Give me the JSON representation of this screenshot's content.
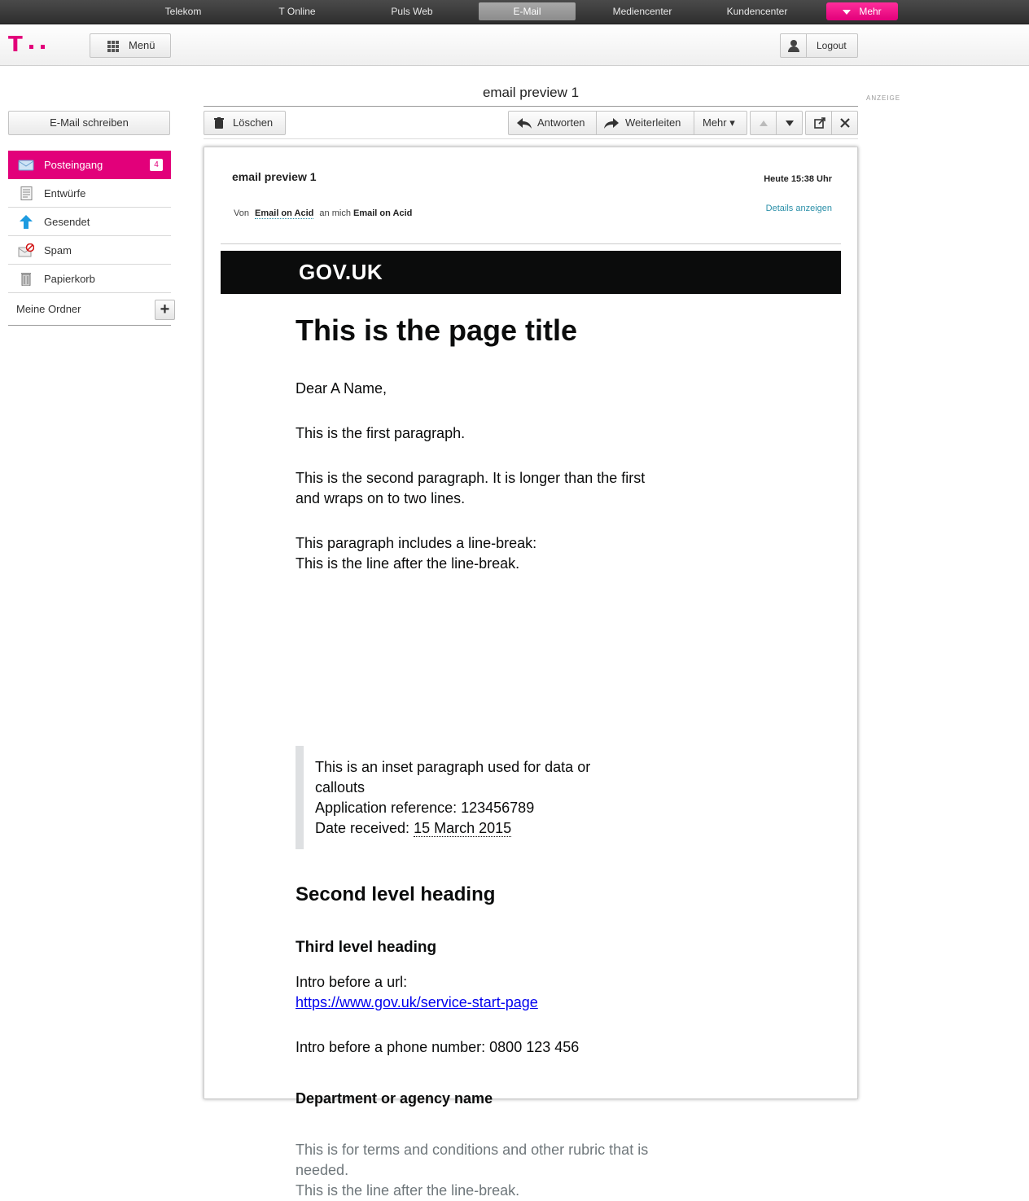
{
  "portal": {
    "items": [
      "Telekom",
      "T Online",
      "Puls Web",
      "E-Mail",
      "Mediencenter",
      "Kundencenter",
      "Mehr"
    ],
    "active": "E-Mail"
  },
  "header": {
    "menu_label": "Menü",
    "logout_label": "Logout"
  },
  "sidebar": {
    "compose_label": "E-Mail schreiben",
    "items": [
      {
        "label": "Posteingang",
        "count": "4",
        "icon": "inbox-icon"
      },
      {
        "label": "Entwürfe",
        "icon": "drafts-icon"
      },
      {
        "label": "Gesendet",
        "icon": "sent-icon"
      },
      {
        "label": "Spam",
        "icon": "spam-icon"
      },
      {
        "label": "Papierkorb",
        "icon": "trash-icon"
      }
    ],
    "my_folders_label": "Meine Ordner",
    "add_folder_symbol": "+"
  },
  "mail_title": "email preview 1",
  "ad_label": "ANZEIGE",
  "toolbar": {
    "delete_label": "Löschen",
    "reply_label": "Antworten",
    "forward_label": "Weiterleiten",
    "more_label": "Mehr ▾"
  },
  "message": {
    "subject": "email preview 1",
    "date": "Heute 15:38 Uhr",
    "from_prefix": "Von",
    "from_name": "Email on Acid",
    "to_prefix": "an mich",
    "to_name": "Email on Acid",
    "details_label": "Details anzeigen"
  },
  "email": {
    "brand": "GOV.UK",
    "title": "This is the page title",
    "greeting": "Dear A Name,",
    "para1": "This is the first paragraph.",
    "para2": "This is the second paragraph. It is longer than the first and wraps on to two lines.",
    "para3_line1": "This paragraph includes a line-break:",
    "para3_line2": "This is the line after the line-break.",
    "inset_line1": "This is an inset paragraph used for data or callouts",
    "inset_line2": "Application reference: 123456789",
    "inset_line3_prefix": "Date received:",
    "inset_date": "15 March 2015",
    "h2": "Second level heading",
    "h3": "Third level heading",
    "url_intro": "Intro before a url:",
    "url": "https://www.gov.uk/service-start-page",
    "phone_line": "Intro before a phone number: 0800 123 456",
    "department": "Department or agency name",
    "terms_line1": "This is for terms and conditions and other rubric that is needed.",
    "terms_line2": "This is the line after the line-break."
  },
  "colors": {
    "brand_magenta": "#e2007a",
    "govuk_black": "#0b0c0c",
    "link_teal": "#2a8fa8"
  }
}
